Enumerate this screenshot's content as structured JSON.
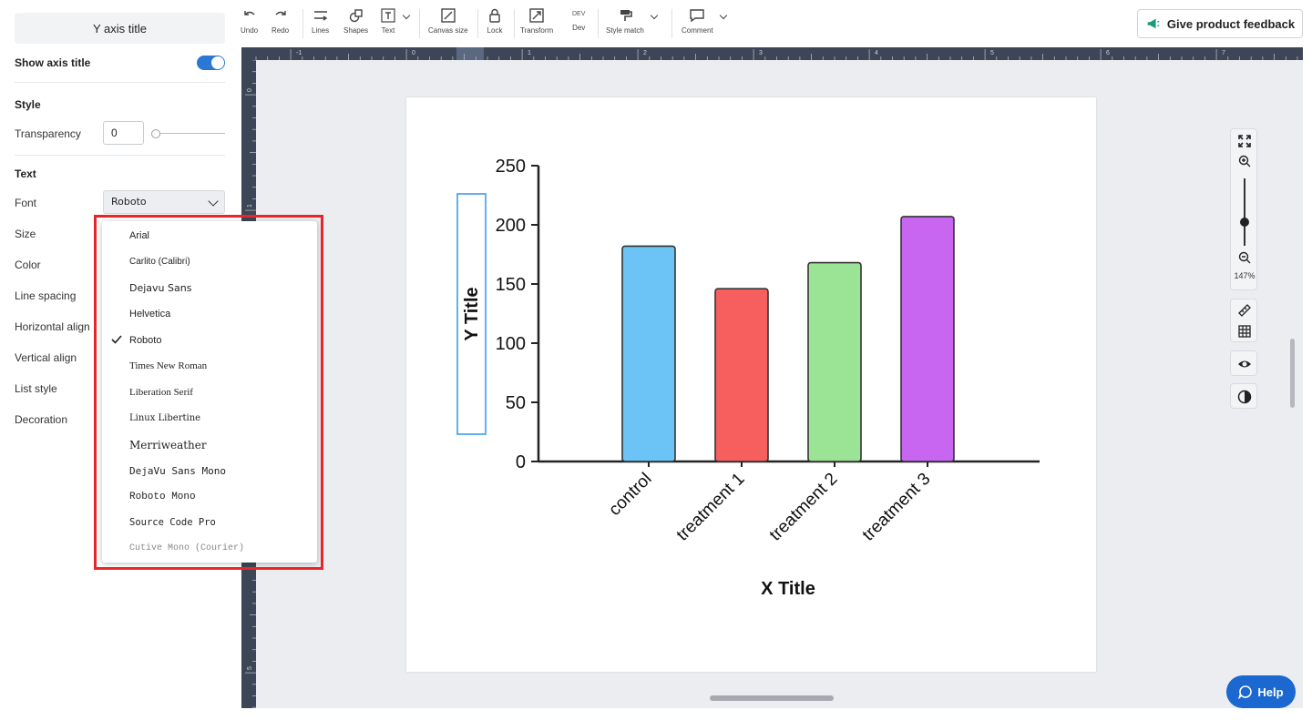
{
  "panel": {
    "header": "Y axis title",
    "show_axis_title_label": "Show axis title",
    "style_section": "Style",
    "transparency_label": "Transparency",
    "transparency_value": "0",
    "text_section": "Text",
    "font_label": "Font",
    "font_value": "Roboto",
    "size_label": "Size",
    "color_label": "Color",
    "line_spacing_label": "Line spacing",
    "horizontal_align_label": "Horizontal align",
    "vertical_align_label": "Vertical align",
    "list_style_label": "List style",
    "decoration_label": "Decoration"
  },
  "font_options": [
    "Arial",
    "Carlito (Calibri)",
    "Dejavu Sans",
    "Helvetica",
    "Roboto",
    "Times New Roman",
    "Liberation Serif",
    "Linux Libertine",
    "Merriweather",
    "DejaVu Sans Mono",
    "Roboto Mono",
    "Source Code Pro",
    "Cutive Mono (Courier)"
  ],
  "selected_font": "Roboto",
  "toolbar": {
    "undo": "Undo",
    "redo": "Redo",
    "lines": "Lines",
    "shapes": "Shapes",
    "text": "Text",
    "canvas_size": "Canvas size",
    "lock": "Lock",
    "transform": "Transform",
    "dev_icon_text": "DEV",
    "dev": "Dev",
    "style_match": "Style match",
    "comment": "Comment",
    "feedback": "Give product feedback"
  },
  "ruler": {
    "top_labels": [
      "-1",
      "0",
      "1",
      "2",
      "3",
      "4",
      "5",
      "6",
      "7"
    ],
    "left_labels": [
      "0",
      "1",
      "5"
    ]
  },
  "zoom": {
    "level": "147%"
  },
  "help": "Help",
  "colors": {
    "accent": "#2a77d4",
    "highlight": "#e8262a",
    "ruler": "#3d4656"
  },
  "chart_data": {
    "type": "bar",
    "categories": [
      "control",
      "treatment 1",
      "treatment 2",
      "treatment 3"
    ],
    "values": [
      182,
      146,
      168,
      207
    ],
    "colors": [
      "#6cc3f5",
      "#f75f5f",
      "#9ce495",
      "#c866f2"
    ],
    "xlabel": "X Title",
    "ylabel": "Y Title",
    "ylim": [
      0,
      250
    ],
    "yticks": [
      0,
      50,
      100,
      150,
      200,
      250
    ],
    "grid": false
  }
}
